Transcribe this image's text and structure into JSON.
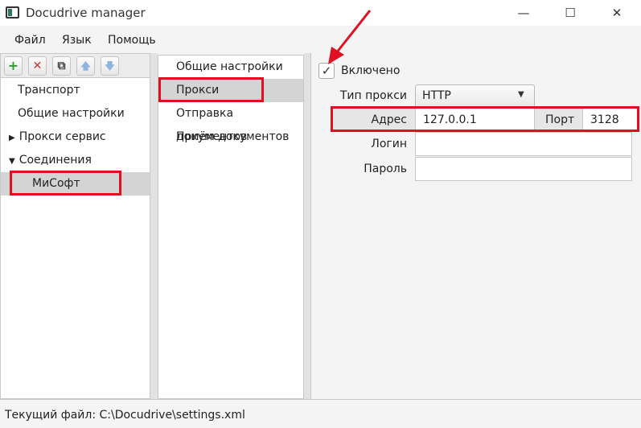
{
  "window": {
    "title": "Docudrive manager",
    "minimize": "—",
    "maximize": "☐",
    "close": "✕"
  },
  "menu": [
    "Файл",
    "Язык",
    "Помощь"
  ],
  "toolbar": {
    "add": "+",
    "delete": "✕",
    "copy": "⧉",
    "up": "🡅",
    "down": "🡇"
  },
  "tree": {
    "items": [
      {
        "label": "Транспорт"
      },
      {
        "label": "Общие настройки"
      },
      {
        "label": "Прокси сервис",
        "arrow": "▶"
      },
      {
        "label": "Соединения",
        "arrow": "▼"
      },
      {
        "label": "МиСофт",
        "selected": true
      }
    ]
  },
  "sections": [
    {
      "label": "Общие настройки"
    },
    {
      "label": "Прокси",
      "selected": true
    },
    {
      "label": "Отправка документов"
    },
    {
      "label": "Приём документов"
    }
  ],
  "proxy": {
    "enabled_label": "Включено",
    "enabled_check": "✓",
    "type_label": "Тип прокси",
    "type_value": "HTTP",
    "type_arrow": "▼",
    "address_label": "Адрес",
    "address_value": "127.0.0.1",
    "port_label": "Порт",
    "port_value": "3128",
    "login_label": "Логин",
    "login_value": "",
    "password_label": "Пароль",
    "password_value": ""
  },
  "status": {
    "text": "Текущий файл: C:\\Docudrive\\settings.xml"
  },
  "colors": {
    "accent_add": "#2aa02a",
    "accent_delete": "#d03030",
    "annotation": "#e01020",
    "selection": "#d4d4d4"
  }
}
